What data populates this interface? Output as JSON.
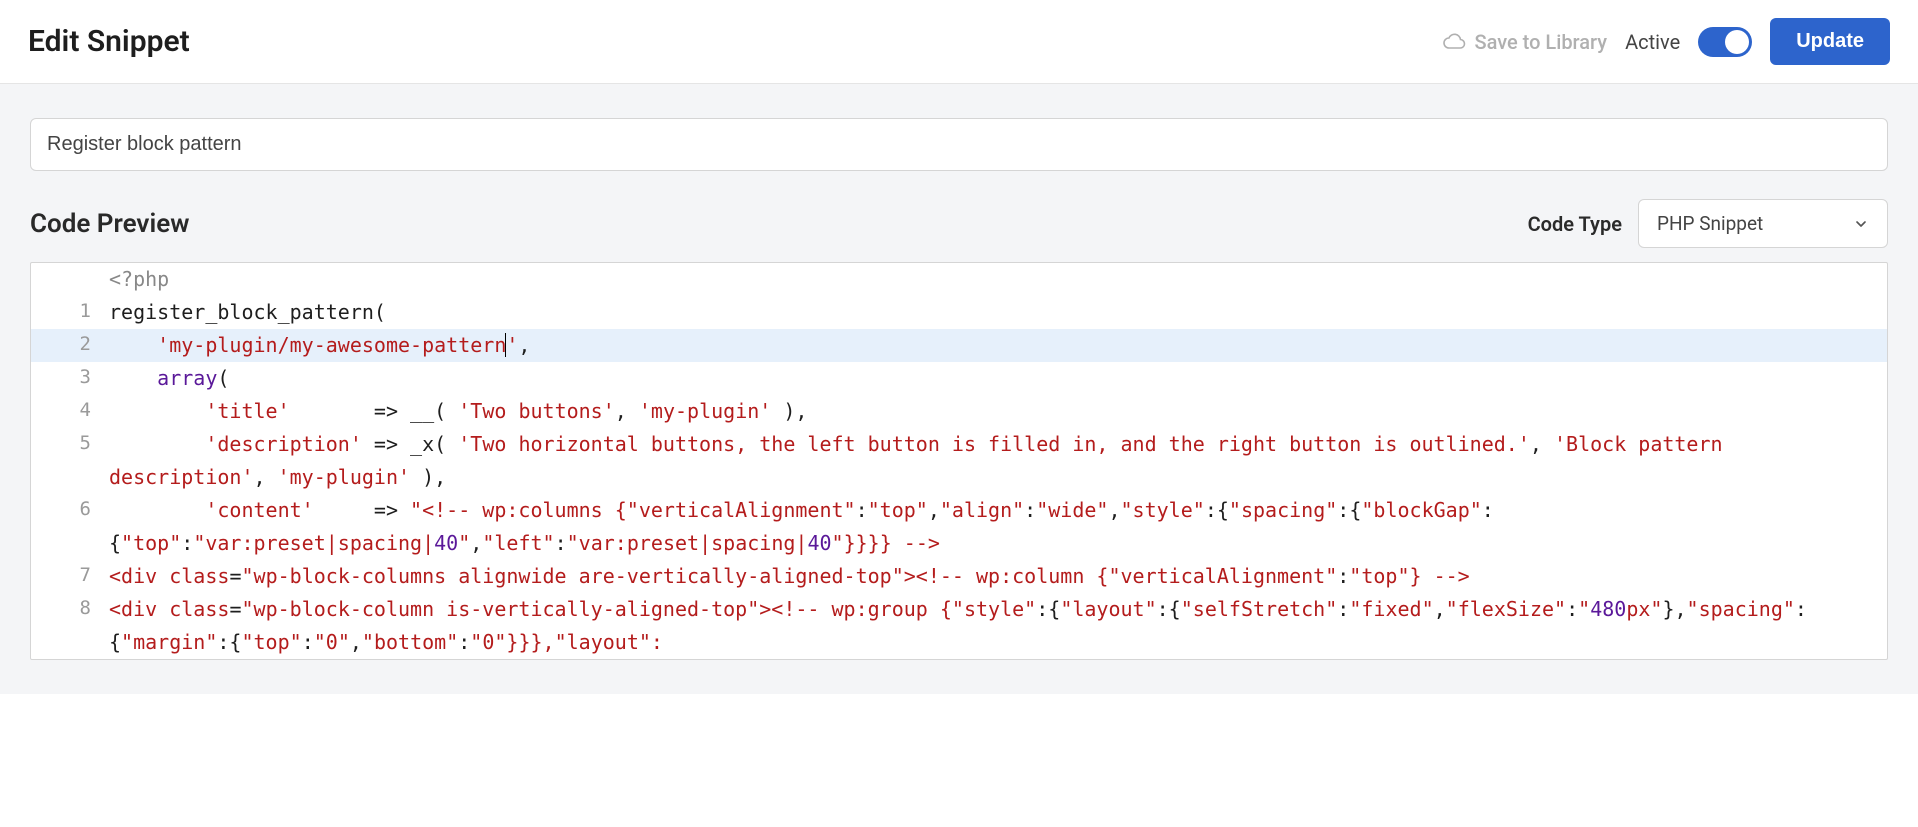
{
  "header": {
    "title": "Edit Snippet",
    "save_to_library": "Save to Library",
    "active_label": "Active",
    "update_button": "Update"
  },
  "snippet_title": "Register block pattern",
  "section": {
    "code_preview": "Code Preview",
    "code_type_label": "Code Type",
    "code_type_value": "PHP Snippet"
  },
  "code": {
    "php_open": "<?php",
    "line1": {
      "fn": "register_block_pattern",
      "paren": "("
    },
    "line2": {
      "indent": "    ",
      "str": "'my-plugin/my-awesome-pattern'",
      "tail": ","
    },
    "line3": {
      "indent": "    ",
      "kw": "array",
      "paren": "("
    },
    "line4": {
      "indent": "        ",
      "key": "'title'",
      "pad": "       => ",
      "fn": "__",
      "open": "( ",
      "a1": "'Two buttons'",
      "sep": ", ",
      "a2": "'my-plugin'",
      "close": " ),"
    },
    "line5": {
      "indent": "        ",
      "key": "'description'",
      "pre": " => ",
      "fn": "_x",
      "open": "( ",
      "a1": "'Two horizontal buttons, the left button is filled in, and the right button is outlined.'",
      "sep1": ", ",
      "a2": "'Block pattern description'",
      "sep2": ", ",
      "a3": "'my-plugin'",
      "close": " ),"
    },
    "line6": {
      "indent": "        ",
      "key": "'content'",
      "pad": "     => ",
      "str_open": "\"<!-- wp:columns {",
      "p1k": "\"verticalAlignment\"",
      "c": ":",
      "p1v": "\"top\"",
      "p2k": "\"align\"",
      "p2v": "\"wide\"",
      "p3k": "\"style\"",
      "ob": ":{",
      "p4k": "\"spacing\"",
      "p5k": "\"blockGap\"",
      "p6k": "\"top\"",
      "p6v": "\"var:preset|spacing|40\"",
      "p7k": "\"left\"",
      "p7v": "\"var:preset|spacing|40\"",
      "close_braces": "}}}} -->",
      "num40": "40"
    },
    "line7": {
      "div_open": "<div ",
      "class_attr": "class",
      "eq": "=",
      "class_val": "\"wp-block-columns alignwide are-vertically-aligned-top\"",
      "gt": ">",
      "cmt_open": "<!-- wp:column {",
      "k": "\"verticalAlignment\"",
      "c": ":",
      "v": "\"top\"",
      "cmt_close": "} -->"
    },
    "line8": {
      "div_open": "<div ",
      "class_attr": "class",
      "eq": "=",
      "class_val": "\"wp-block-column is-vertically-aligned-top\"",
      "gt": ">",
      "cmt_open": "<!-- wp:group {",
      "k_style": "\"style\"",
      "c": ":",
      "ob": "{",
      "k_layout": "\"layout\"",
      "k_self": "\"selfStretch\"",
      "v_fixed": "\"fixed\"",
      "k_flex": "\"flexSize\"",
      "v_480": "\"480px\"",
      "n480": "480",
      "k_spacing": "\"spacing\"",
      "k_margin": "\"margin\"",
      "k_top": "\"top\"",
      "v0a": "\"0\"",
      "k_bottom": "\"bottom\"",
      "v0b": "\"0\"",
      "tail": "}}},",
      "layout_tail": "\"layout\":"
    }
  }
}
